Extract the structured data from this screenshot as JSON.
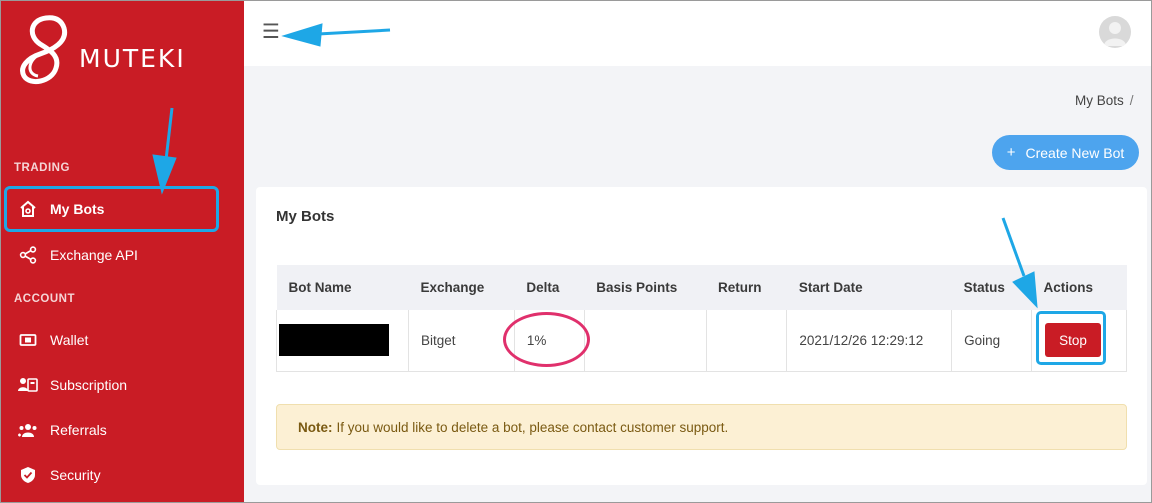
{
  "app": {
    "logo_text": "MUTEKI"
  },
  "sidebar": {
    "sections": [
      {
        "title": "TRADING"
      },
      {
        "title": "ACCOUNT"
      }
    ],
    "items": [
      {
        "label": "My Bots",
        "icon": "home-icon"
      },
      {
        "label": "Exchange API",
        "icon": "share-icon"
      },
      {
        "label": "Wallet",
        "icon": "wallet-icon"
      },
      {
        "label": "Subscription",
        "icon": "subscription-icon"
      },
      {
        "label": "Referrals",
        "icon": "users-icon"
      },
      {
        "label": "Security",
        "icon": "shield-icon"
      }
    ]
  },
  "header": {
    "menu_icon": "hamburger-icon",
    "avatar_icon": "user-avatar-icon"
  },
  "breadcrumb": {
    "current": "My Bots",
    "separator": "/"
  },
  "actions": {
    "create_label": "Create New Bot",
    "create_icon": "+"
  },
  "card": {
    "title": "My Bots",
    "columns": [
      "Bot Name",
      "Exchange",
      "Delta",
      "Basis Points",
      "Return",
      "Start Date",
      "Status",
      "Actions"
    ],
    "rows": [
      {
        "bot_name": "",
        "exchange": "Bitget",
        "delta": "1%",
        "basis_points": "",
        "return": "",
        "start_date": "2021/12/26 12:29:12",
        "status": "Going",
        "action": "Stop"
      }
    ]
  },
  "note": {
    "label": "Note:",
    "text": "If you would like to delete a bot, please contact customer support."
  },
  "colors": {
    "sidebar_bg": "#c91c25",
    "accent_blue": "#4da4ee",
    "status_going": "#2e9e64",
    "annotation_blue": "#1ea7e6",
    "annotation_pink": "#e0306c"
  }
}
